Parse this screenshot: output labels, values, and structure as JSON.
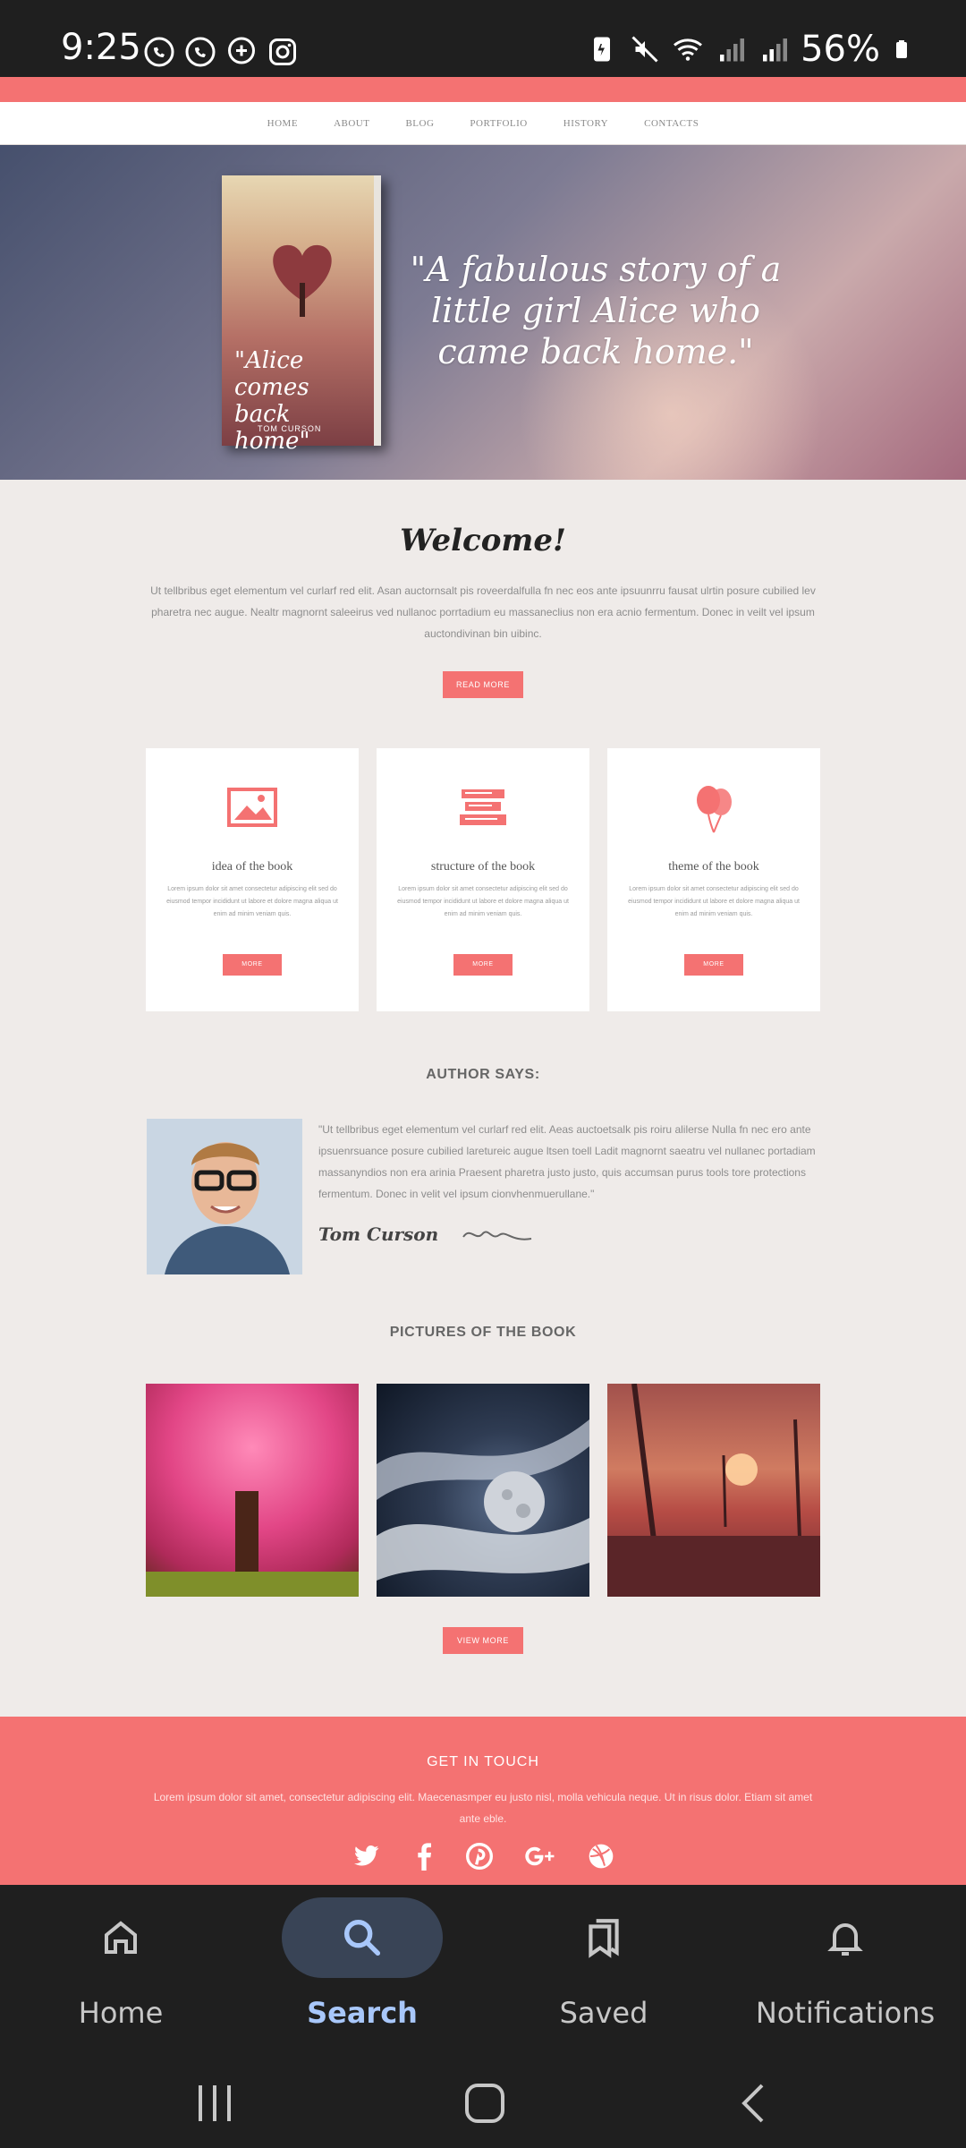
{
  "status_bar": {
    "time": "9:25",
    "battery": "56%"
  },
  "site": {
    "nav": [
      "HOME",
      "ABOUT",
      "BLOG",
      "PORTFOLIO",
      "HISTORY",
      "CONTACTS"
    ],
    "hero": {
      "book_title": "\"Alice comes back home\"",
      "book_author": "TOM CURSON",
      "quote": "\"A fabulous story of a little girl Alice who came back home.\""
    },
    "welcome": {
      "title": "Welcome!",
      "text": "Ut tellbribus eget elementum vel curlarf red elit. Asan auctornsalt pis roveerdalfulla fn nec eos ante ipsuunrru fausat ulrtin posure cubilied lev pharetra nec augue. Nealtr magnornt saleeirus ved nullanoc porrtadium eu massaneclius non era acnio fermentum. Donec in veilt vel ipsum auctondivinan bin uibinc.",
      "button": "READ MORE"
    },
    "features": [
      {
        "title": "idea of the book",
        "text": "Lorem ipsum dolor sit amet consectetur adipiscing elit sed do eiusmod tempor incididunt ut labore et dolore magna aliqua ut enim ad minim veniam quis.",
        "button": "MORE",
        "icon": "image-icon"
      },
      {
        "title": "structure of the book",
        "text": "Lorem ipsum dolor sit amet consectetur adipiscing elit sed do eiusmod tempor incididunt ut labore et dolore magna aliqua ut enim ad minim veniam quis.",
        "button": "MORE",
        "icon": "books-icon"
      },
      {
        "title": "theme of the book",
        "text": "Lorem ipsum dolor sit amet consectetur adipiscing elit sed do eiusmod tempor incididunt ut labore et dolore magna aliqua ut enim ad minim veniam quis.",
        "button": "MORE",
        "icon": "balloons-icon"
      }
    ],
    "author": {
      "section_title": "AUTHOR SAYS:",
      "quote": "\"Ut tellbribus eget elementum vel curlarf red elit. Aeas auctoetsalk pis roiru alilerse Nulla fn nec ero ante ipsuenrsuance posure cubilied laretureic augue ltsen toell Ladit magnornt saeatru vel nullanec portadiam massanyndios non era arinia Praesent pharetra justo justo, quis accumsan purus tools tore protections fermentum. Donec in velit vel ipsum cionvhenmuerullane.\"",
      "name": "Tom Curson"
    },
    "pictures": {
      "section_title": "PICTURES OF THE BOOK",
      "button": "VIEW MORE"
    },
    "footer": {
      "title": "GET IN  TOUCH",
      "text": "Lorem ipsum dolor sit amet, consectetur adipiscing elit. Maecenasmper eu justo nisl, molla vehicula neque. Ut in risus dolor. Etiam sit amet ante eble.",
      "social": [
        "twitter-icon",
        "facebook-icon",
        "pinterest-icon",
        "google-plus-icon",
        "dribbble-icon"
      ]
    }
  },
  "bottom_nav": {
    "items": [
      {
        "label": "Home",
        "active": false
      },
      {
        "label": "Search",
        "active": true
      },
      {
        "label": "Saved",
        "active": false
      },
      {
        "label": "Notifications",
        "active": false
      }
    ]
  },
  "colors": {
    "accent": "#f47272",
    "active_label": "#a8c7fa"
  }
}
